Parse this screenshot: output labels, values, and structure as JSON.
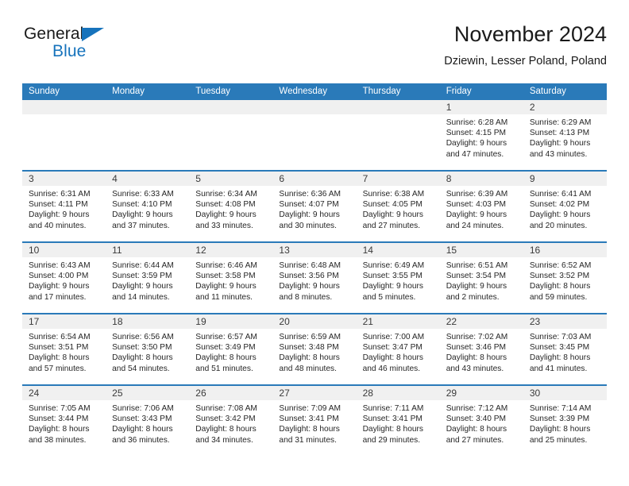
{
  "brand": {
    "name_top": "General",
    "name_bottom": "Blue",
    "accent_color": "#1673bc",
    "logo_icon": "triangle-icon"
  },
  "header": {
    "title": "November 2024",
    "subtitle": "Dziewin, Lesser Poland, Poland"
  },
  "theme": {
    "header_blue": "#2a7ab9",
    "day_band_gray": "#f0f0f0",
    "text_dark": "#1a1a1a"
  },
  "weekdays": [
    "Sunday",
    "Monday",
    "Tuesday",
    "Wednesday",
    "Thursday",
    "Friday",
    "Saturday"
  ],
  "weeks": [
    [
      {
        "day": "",
        "sunrise": "",
        "sunset": "",
        "daylight_line1": "",
        "daylight_line2": "",
        "empty": true
      },
      {
        "day": "",
        "sunrise": "",
        "sunset": "",
        "daylight_line1": "",
        "daylight_line2": "",
        "empty": true
      },
      {
        "day": "",
        "sunrise": "",
        "sunset": "",
        "daylight_line1": "",
        "daylight_line2": "",
        "empty": true
      },
      {
        "day": "",
        "sunrise": "",
        "sunset": "",
        "daylight_line1": "",
        "daylight_line2": "",
        "empty": true
      },
      {
        "day": "",
        "sunrise": "",
        "sunset": "",
        "daylight_line1": "",
        "daylight_line2": "",
        "empty": true
      },
      {
        "day": "1",
        "sunrise": "Sunrise: 6:28 AM",
        "sunset": "Sunset: 4:15 PM",
        "daylight_line1": "Daylight: 9 hours",
        "daylight_line2": "and 47 minutes."
      },
      {
        "day": "2",
        "sunrise": "Sunrise: 6:29 AM",
        "sunset": "Sunset: 4:13 PM",
        "daylight_line1": "Daylight: 9 hours",
        "daylight_line2": "and 43 minutes."
      }
    ],
    [
      {
        "day": "3",
        "sunrise": "Sunrise: 6:31 AM",
        "sunset": "Sunset: 4:11 PM",
        "daylight_line1": "Daylight: 9 hours",
        "daylight_line2": "and 40 minutes."
      },
      {
        "day": "4",
        "sunrise": "Sunrise: 6:33 AM",
        "sunset": "Sunset: 4:10 PM",
        "daylight_line1": "Daylight: 9 hours",
        "daylight_line2": "and 37 minutes."
      },
      {
        "day": "5",
        "sunrise": "Sunrise: 6:34 AM",
        "sunset": "Sunset: 4:08 PM",
        "daylight_line1": "Daylight: 9 hours",
        "daylight_line2": "and 33 minutes."
      },
      {
        "day": "6",
        "sunrise": "Sunrise: 6:36 AM",
        "sunset": "Sunset: 4:07 PM",
        "daylight_line1": "Daylight: 9 hours",
        "daylight_line2": "and 30 minutes."
      },
      {
        "day": "7",
        "sunrise": "Sunrise: 6:38 AM",
        "sunset": "Sunset: 4:05 PM",
        "daylight_line1": "Daylight: 9 hours",
        "daylight_line2": "and 27 minutes."
      },
      {
        "day": "8",
        "sunrise": "Sunrise: 6:39 AM",
        "sunset": "Sunset: 4:03 PM",
        "daylight_line1": "Daylight: 9 hours",
        "daylight_line2": "and 24 minutes."
      },
      {
        "day": "9",
        "sunrise": "Sunrise: 6:41 AM",
        "sunset": "Sunset: 4:02 PM",
        "daylight_line1": "Daylight: 9 hours",
        "daylight_line2": "and 20 minutes."
      }
    ],
    [
      {
        "day": "10",
        "sunrise": "Sunrise: 6:43 AM",
        "sunset": "Sunset: 4:00 PM",
        "daylight_line1": "Daylight: 9 hours",
        "daylight_line2": "and 17 minutes."
      },
      {
        "day": "11",
        "sunrise": "Sunrise: 6:44 AM",
        "sunset": "Sunset: 3:59 PM",
        "daylight_line1": "Daylight: 9 hours",
        "daylight_line2": "and 14 minutes."
      },
      {
        "day": "12",
        "sunrise": "Sunrise: 6:46 AM",
        "sunset": "Sunset: 3:58 PM",
        "daylight_line1": "Daylight: 9 hours",
        "daylight_line2": "and 11 minutes."
      },
      {
        "day": "13",
        "sunrise": "Sunrise: 6:48 AM",
        "sunset": "Sunset: 3:56 PM",
        "daylight_line1": "Daylight: 9 hours",
        "daylight_line2": "and 8 minutes."
      },
      {
        "day": "14",
        "sunrise": "Sunrise: 6:49 AM",
        "sunset": "Sunset: 3:55 PM",
        "daylight_line1": "Daylight: 9 hours",
        "daylight_line2": "and 5 minutes."
      },
      {
        "day": "15",
        "sunrise": "Sunrise: 6:51 AM",
        "sunset": "Sunset: 3:54 PM",
        "daylight_line1": "Daylight: 9 hours",
        "daylight_line2": "and 2 minutes."
      },
      {
        "day": "16",
        "sunrise": "Sunrise: 6:52 AM",
        "sunset": "Sunset: 3:52 PM",
        "daylight_line1": "Daylight: 8 hours",
        "daylight_line2": "and 59 minutes."
      }
    ],
    [
      {
        "day": "17",
        "sunrise": "Sunrise: 6:54 AM",
        "sunset": "Sunset: 3:51 PM",
        "daylight_line1": "Daylight: 8 hours",
        "daylight_line2": "and 57 minutes."
      },
      {
        "day": "18",
        "sunrise": "Sunrise: 6:56 AM",
        "sunset": "Sunset: 3:50 PM",
        "daylight_line1": "Daylight: 8 hours",
        "daylight_line2": "and 54 minutes."
      },
      {
        "day": "19",
        "sunrise": "Sunrise: 6:57 AM",
        "sunset": "Sunset: 3:49 PM",
        "daylight_line1": "Daylight: 8 hours",
        "daylight_line2": "and 51 minutes."
      },
      {
        "day": "20",
        "sunrise": "Sunrise: 6:59 AM",
        "sunset": "Sunset: 3:48 PM",
        "daylight_line1": "Daylight: 8 hours",
        "daylight_line2": "and 48 minutes."
      },
      {
        "day": "21",
        "sunrise": "Sunrise: 7:00 AM",
        "sunset": "Sunset: 3:47 PM",
        "daylight_line1": "Daylight: 8 hours",
        "daylight_line2": "and 46 minutes."
      },
      {
        "day": "22",
        "sunrise": "Sunrise: 7:02 AM",
        "sunset": "Sunset: 3:46 PM",
        "daylight_line1": "Daylight: 8 hours",
        "daylight_line2": "and 43 minutes."
      },
      {
        "day": "23",
        "sunrise": "Sunrise: 7:03 AM",
        "sunset": "Sunset: 3:45 PM",
        "daylight_line1": "Daylight: 8 hours",
        "daylight_line2": "and 41 minutes."
      }
    ],
    [
      {
        "day": "24",
        "sunrise": "Sunrise: 7:05 AM",
        "sunset": "Sunset: 3:44 PM",
        "daylight_line1": "Daylight: 8 hours",
        "daylight_line2": "and 38 minutes."
      },
      {
        "day": "25",
        "sunrise": "Sunrise: 7:06 AM",
        "sunset": "Sunset: 3:43 PM",
        "daylight_line1": "Daylight: 8 hours",
        "daylight_line2": "and 36 minutes."
      },
      {
        "day": "26",
        "sunrise": "Sunrise: 7:08 AM",
        "sunset": "Sunset: 3:42 PM",
        "daylight_line1": "Daylight: 8 hours",
        "daylight_line2": "and 34 minutes."
      },
      {
        "day": "27",
        "sunrise": "Sunrise: 7:09 AM",
        "sunset": "Sunset: 3:41 PM",
        "daylight_line1": "Daylight: 8 hours",
        "daylight_line2": "and 31 minutes."
      },
      {
        "day": "28",
        "sunrise": "Sunrise: 7:11 AM",
        "sunset": "Sunset: 3:41 PM",
        "daylight_line1": "Daylight: 8 hours",
        "daylight_line2": "and 29 minutes."
      },
      {
        "day": "29",
        "sunrise": "Sunrise: 7:12 AM",
        "sunset": "Sunset: 3:40 PM",
        "daylight_line1": "Daylight: 8 hours",
        "daylight_line2": "and 27 minutes."
      },
      {
        "day": "30",
        "sunrise": "Sunrise: 7:14 AM",
        "sunset": "Sunset: 3:39 PM",
        "daylight_line1": "Daylight: 8 hours",
        "daylight_line2": "and 25 minutes."
      }
    ]
  ]
}
